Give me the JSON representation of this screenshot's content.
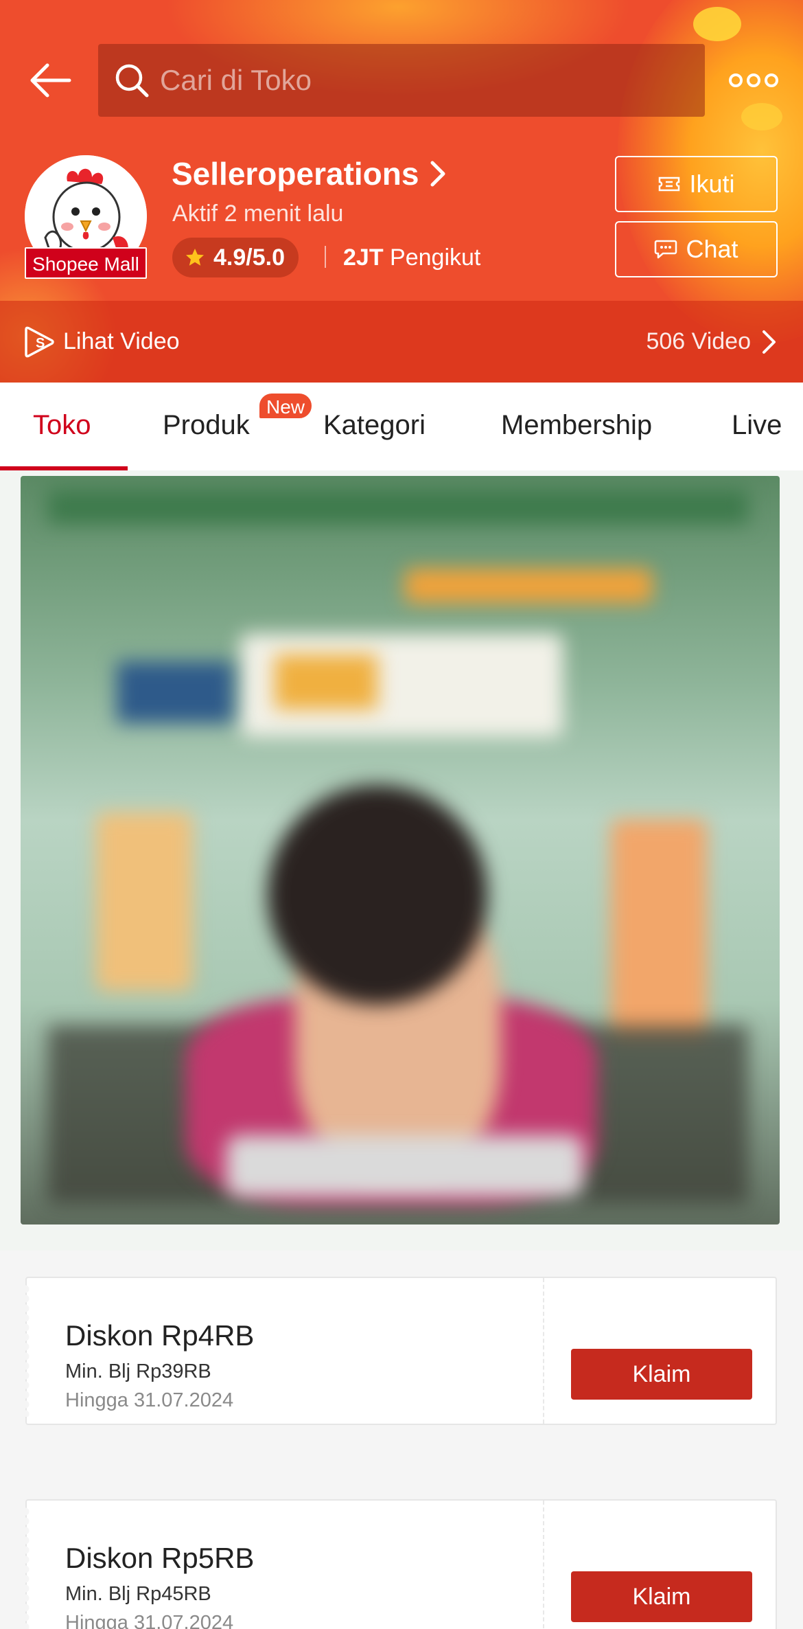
{
  "header": {
    "search_placeholder": "Cari di Toko",
    "shop_name": "Selleroperations",
    "active_status": "Aktif 2 menit lalu",
    "rating": "4.9/5.0",
    "followers_count": "2JT",
    "followers_label": "Pengikut",
    "mall_badge": "Shopee Mall",
    "follow_label": "Ikuti",
    "chat_label": "Chat",
    "video_label": "Lihat Video",
    "video_count": "506 Video"
  },
  "tabs": [
    {
      "label": "Toko",
      "active": true
    },
    {
      "label": "Produk",
      "badge": "New"
    },
    {
      "label": "Kategori"
    },
    {
      "label": "Membership"
    },
    {
      "label": "Live"
    }
  ],
  "vouchers": [
    {
      "title": "Diskon Rp4RB",
      "min": "Min. Blj Rp39RB",
      "expiry": "Hingga 31.07.2024",
      "claim": "Klaim"
    },
    {
      "title": "Diskon Rp5RB",
      "min": "Min. Blj Rp45RB",
      "expiry": "Hingga 31.07.2024",
      "claim": "Klaim"
    }
  ],
  "colors": {
    "brand": "#ee4d2d",
    "accent_red": "#d0011b",
    "claim_button": "#c62a1e"
  }
}
